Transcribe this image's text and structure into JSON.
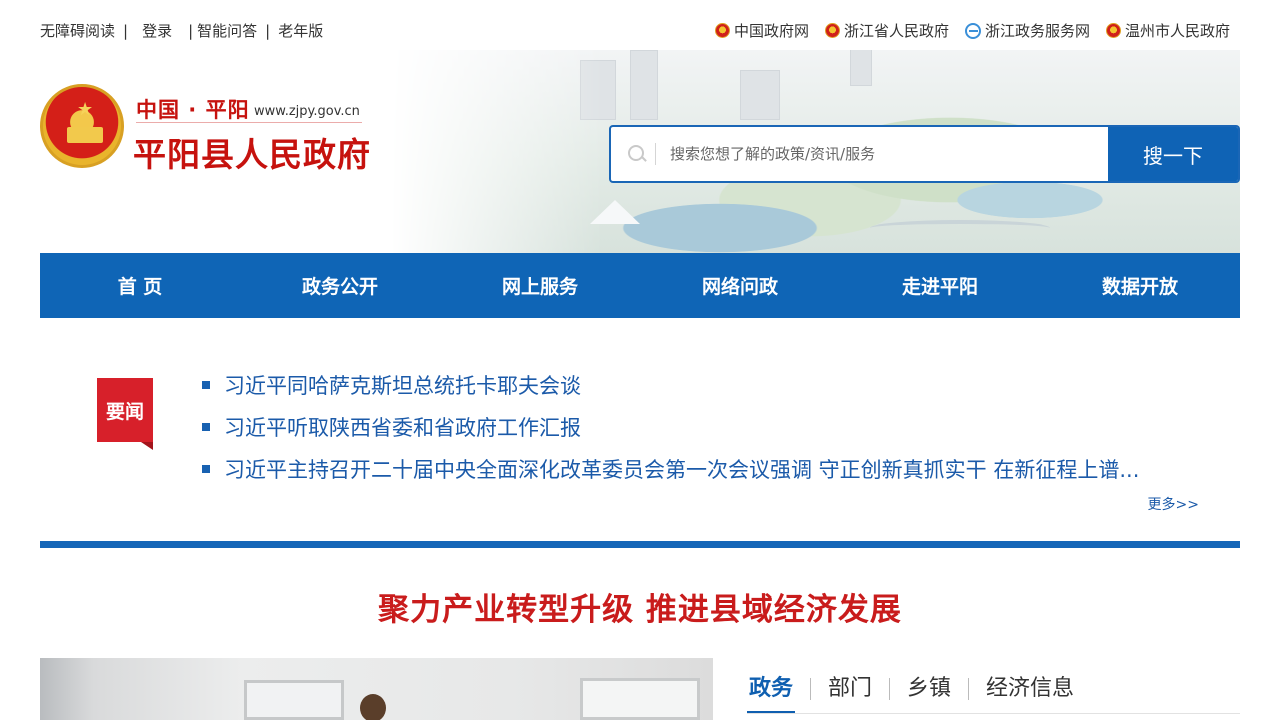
{
  "topbar": {
    "left_links": [
      "无障碍阅读",
      "登录",
      "智能问答",
      "老年版"
    ],
    "right_links": [
      {
        "label": "中国政府网",
        "icon": "national-emblem-icon"
      },
      {
        "label": "浙江省人民政府",
        "icon": "national-emblem-icon"
      },
      {
        "label": "浙江政务服务网",
        "icon": "globe-icon"
      },
      {
        "label": "温州市人民政府",
        "icon": "national-emblem-icon"
      }
    ]
  },
  "logo": {
    "subtitle": "中国 · 平阳",
    "url": "www.zjpy.gov.cn",
    "title": "平阳县人民政府"
  },
  "search": {
    "placeholder": "搜索您想了解的政策/资讯/服务",
    "button": "搜一下"
  },
  "nav": [
    "首 页",
    "政务公开",
    "网上服务",
    "网络问政",
    "走进平阳",
    "数据开放"
  ],
  "news": {
    "badge": "要闻",
    "items": [
      "习近平同哈萨克斯坦总统托卡耶夫会谈",
      "习近平听取陕西省委和省政府工作汇报",
      "习近平主持召开二十届中央全面深化改革委员会第一次会议强调 守正创新真抓实干 在新征程上谱..."
    ],
    "more": "更多>>"
  },
  "banner": "聚力产业转型升级 推进县域经济发展",
  "tabs": {
    "items": [
      "政务",
      "部门",
      "乡镇",
      "经济信息"
    ],
    "active_index": 0
  },
  "colors": {
    "nav_blue": "#0f65b6",
    "brand_red": "#c6120e",
    "link_blue": "#1b5aa9",
    "badge_red": "#d7202a"
  }
}
